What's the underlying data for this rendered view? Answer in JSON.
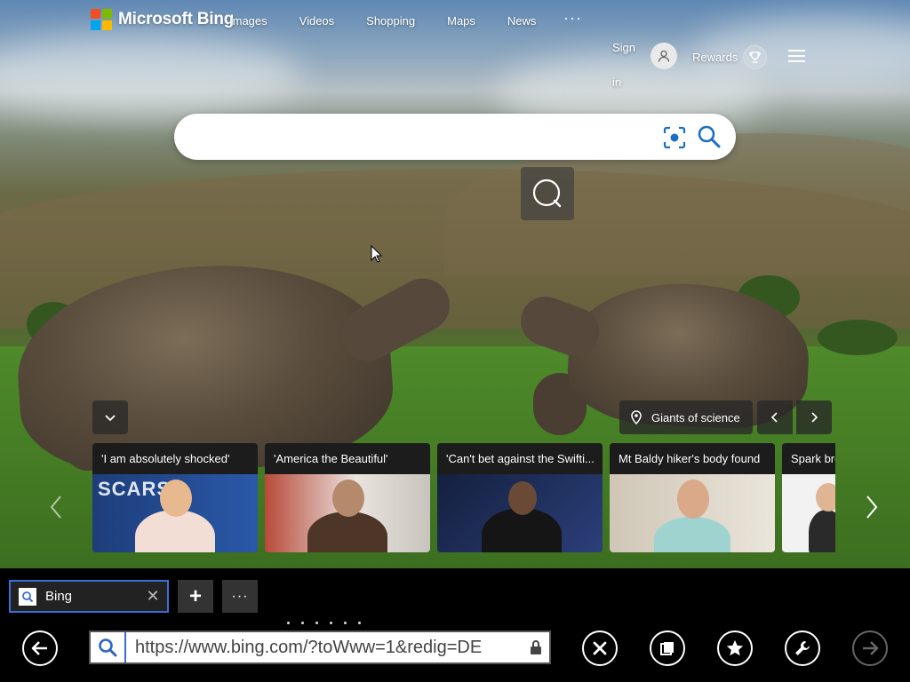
{
  "brand": {
    "name": "Microsoft Bing",
    "logo_colors": [
      "#f25022",
      "#7fba00",
      "#00a4ef",
      "#ffb900"
    ]
  },
  "nav": {
    "links": [
      "Images",
      "Videos",
      "Shopping",
      "Maps",
      "News"
    ],
    "more": "···",
    "sign_in": "Sign in",
    "rewards": "Rewards"
  },
  "search": {
    "value": "",
    "placeholder": ""
  },
  "carousel": {
    "location_label": "Giants of science",
    "cards": [
      {
        "title": "'I am absolutely shocked'"
      },
      {
        "title": "'America the Beautiful'"
      },
      {
        "title": "'Can't bet against the Swifti..."
      },
      {
        "title": "Mt Baldy hiker's body found"
      },
      {
        "title": "Spark bre"
      }
    ]
  },
  "browser": {
    "tab": {
      "label": "Bing",
      "close": "✕"
    },
    "new_tab": "+",
    "tab_menu": "···",
    "address": "https://www.bing.com/?toWww=1&redig=DE",
    "accent_color": "#3a6fd8"
  }
}
